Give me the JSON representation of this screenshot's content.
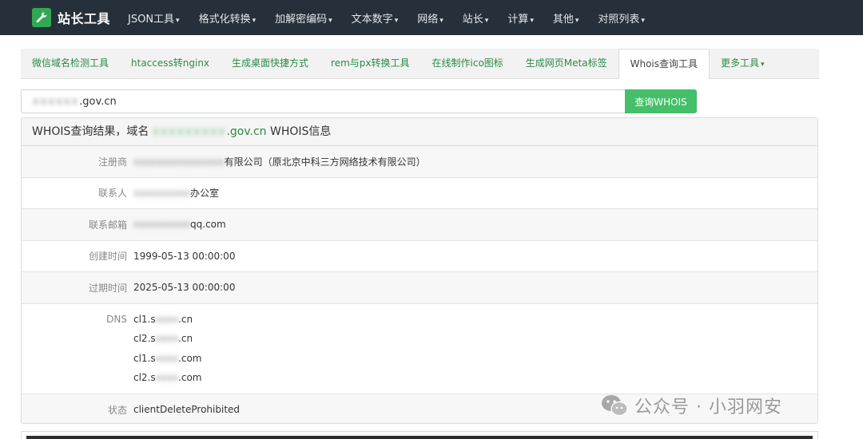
{
  "brand": {
    "name": "站长工具",
    "icon": "wrench-icon",
    "icon_bg": "#33a853"
  },
  "nav": {
    "items": [
      "JSON工具",
      "格式化转换",
      "加解密编码",
      "文本数字",
      "网络",
      "站长",
      "计算",
      "其他",
      "对照列表"
    ],
    "caret": "▾"
  },
  "tabs": {
    "items": [
      "微信域名检测工具",
      "htaccess转nginx",
      "生成桌面快捷方式",
      "rem与px转换工具",
      "在线制作ico图标",
      "生成网页Meta标签",
      "Whois查询工具",
      "更多工具"
    ],
    "active": "Whois查询工具",
    "more_caret": "▾"
  },
  "search": {
    "value_hidden": "xxxxxx",
    "value_visible": ".gov.cn",
    "button_label": "查询WHOIS",
    "button_color": "#45bf69"
  },
  "result": {
    "heading_prefix": "WHOIS查询结果，域名",
    "domain_hidden": "xxxxxxxxx",
    "domain_visible": ".gov.cn",
    "heading_suffix": "WHOIS信息",
    "rows": {
      "registrar": {
        "label": "注册商",
        "hidden": "xxxxxxxxxxxxxxxx",
        "visible": "有限公司（原北京中科三方网络技术有限公司）"
      },
      "contact": {
        "label": "联系人",
        "hidden": "xxxxxxxxxx",
        "visible": "办公室"
      },
      "email": {
        "label": "联系邮箱",
        "hidden": "xxxxxxxxxx",
        "visible": "qq.com"
      },
      "created": {
        "label": "创建时间",
        "value": "1999-05-13 00:00:00"
      },
      "expires": {
        "label": "过期时间",
        "value": "2025-05-13 00:00:00"
      },
      "dns": {
        "label": "DNS",
        "servers": [
          {
            "prefix": "cl1.s",
            "hidden": "xxxx",
            "suffix": ".cn"
          },
          {
            "prefix": "cl2.s",
            "hidden": "xxxx",
            "suffix": ".cn"
          },
          {
            "prefix": "cl1.s",
            "hidden": "xxxx",
            "suffix": ".com"
          },
          {
            "prefix": "cl2.s",
            "hidden": "xxxx",
            "suffix": ".com"
          }
        ]
      },
      "status": {
        "label": "状态",
        "value": "clientDeleteProhibited"
      }
    }
  },
  "watermark": {
    "text": "公众号 · 小羽网安",
    "icon": "wechat-icon"
  }
}
